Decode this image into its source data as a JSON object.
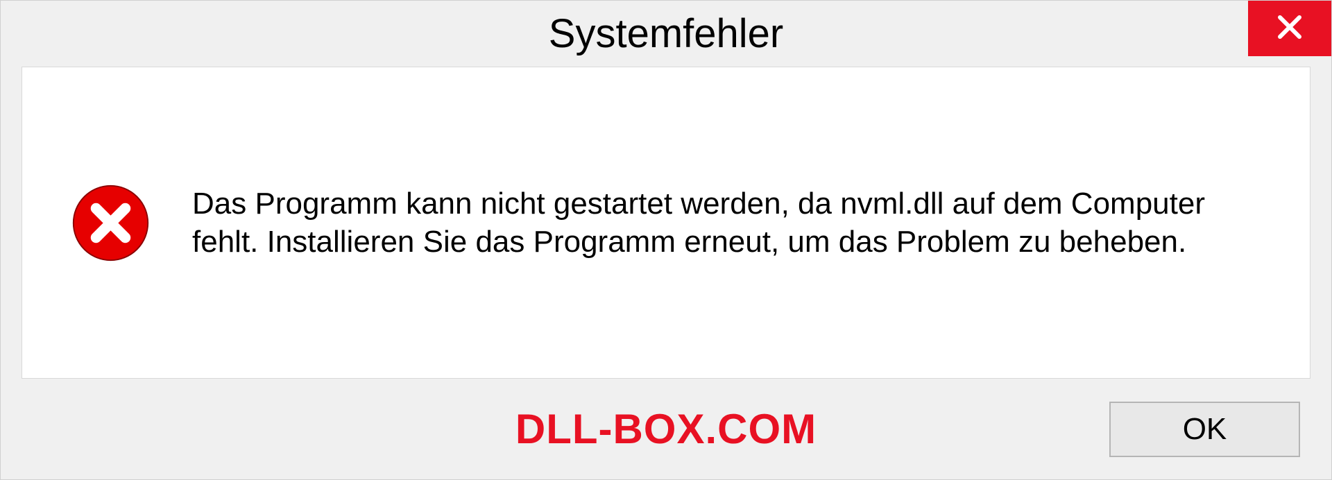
{
  "dialog": {
    "title": "Systemfehler",
    "message": "Das Programm kann nicht gestartet werden, da nvml.dll auf dem Computer fehlt. Installieren Sie das Programm erneut, um das Problem zu beheben.",
    "ok_label": "OK"
  },
  "watermark": "DLL-BOX.COM",
  "colors": {
    "accent_red": "#e81123"
  }
}
